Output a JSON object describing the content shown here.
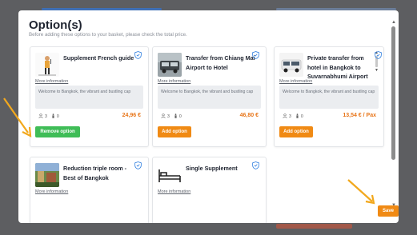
{
  "modal": {
    "title": "Option(s)",
    "subtitle": "Before adding these options to your basket, please check the total price."
  },
  "cards": [
    {
      "title": "Supplement French guide",
      "more": "More information",
      "desc": "Welcome to Bangkok, the vibrant and bustling cap",
      "adults": "3",
      "kids": "0",
      "price": "24,96 €",
      "button": "Remove option",
      "button_state": "remove"
    },
    {
      "title": "Transfer from Chiang Mai Airport to Hotel",
      "more": "More information",
      "desc": "Welcome to Bangkok, the vibrant and bustling cap",
      "adults": "3",
      "kids": "0",
      "price": "46,80 €",
      "button": "Add option",
      "button_state": "add"
    },
    {
      "title": "Private transfer from hotel in Bangkok to Suvarnabhumi Airport",
      "more": "More information",
      "desc": "Welcome to Bangkok, the vibrant and bustling cap",
      "adults": "3",
      "kids": "0",
      "price": "13,54 € / Pax",
      "button": "Add option",
      "button_state": "add"
    },
    {
      "title": "Reduction triple room - Best of Bangkok",
      "more": "More information"
    },
    {
      "title": "Single Supplement",
      "more": "More information"
    }
  ],
  "footer": {
    "save_label": "Save"
  },
  "colors": {
    "accent": "#f08a14",
    "remove": "#3fbd57",
    "price": "#e8761a",
    "shield": "#2f7fe0"
  }
}
